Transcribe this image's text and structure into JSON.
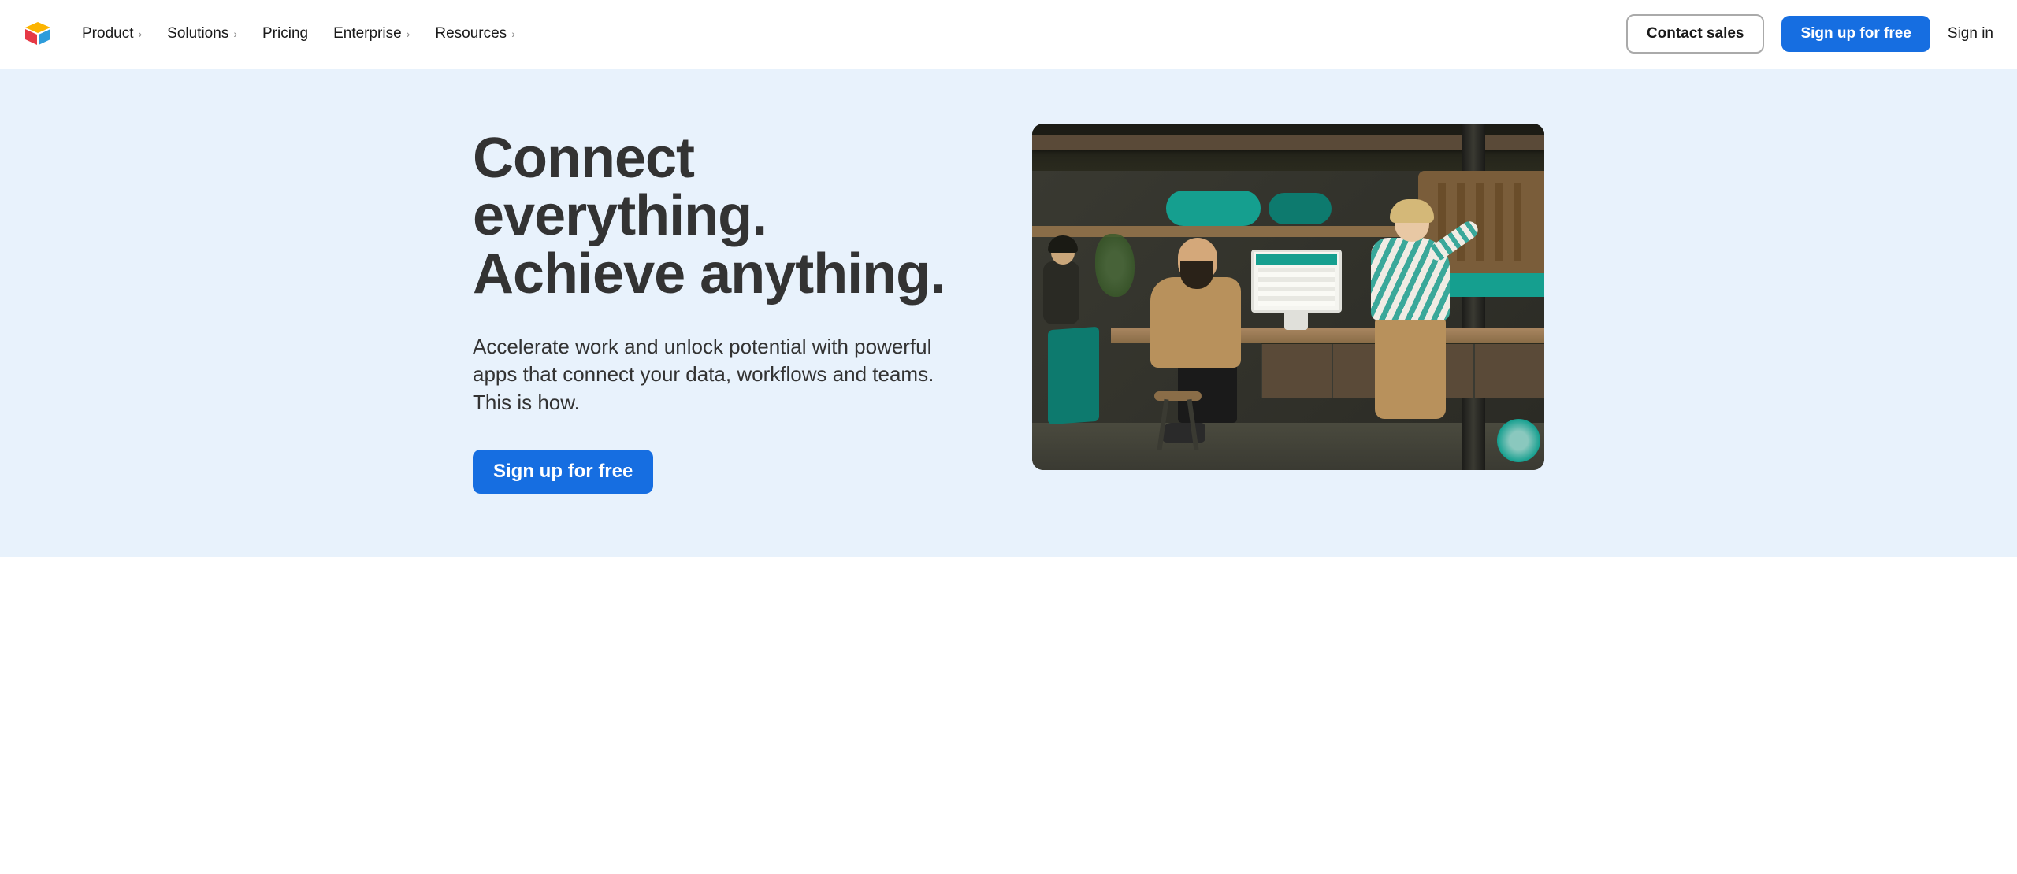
{
  "header": {
    "nav": [
      {
        "label": "Product",
        "has_dropdown": true
      },
      {
        "label": "Solutions",
        "has_dropdown": true
      },
      {
        "label": "Pricing",
        "has_dropdown": false
      },
      {
        "label": "Enterprise",
        "has_dropdown": true
      },
      {
        "label": "Resources",
        "has_dropdown": true
      }
    ],
    "contact_sales": "Contact sales",
    "signup": "Sign up for free",
    "signin": "Sign in"
  },
  "hero": {
    "title": "Connect everything. Achieve anything.",
    "subtitle": "Accelerate work and unlock potential with powerful apps that connect your data, workflows and teams. This is how.",
    "cta": "Sign up for free",
    "image_alt": "People working in a furniture workshop with a computer showing a data interface"
  },
  "colors": {
    "primary": "#166ee1",
    "hero_bg": "#e8f2fc",
    "text": "#333333",
    "teal": "#159f8f"
  }
}
